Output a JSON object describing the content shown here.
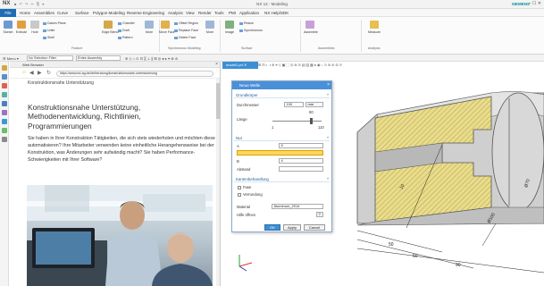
{
  "titlebar": {
    "app_logo": "NX",
    "title": "NX 12 - Modeling",
    "brand": "SIEMENS",
    "window_buttons": "–  ☐  ✕"
  },
  "menu": {
    "file": "File",
    "items": [
      "Home",
      "Assemblies",
      "Curve",
      "Surface",
      "Polygon Modeling",
      "Reverse Engineering",
      "Analysis",
      "View",
      "Render",
      "Tools",
      "PMI",
      "Application",
      "NX Help/SDK"
    ]
  },
  "ribbon": {
    "buttons": [
      "Sketch",
      "Extrude",
      "Hole",
      "Edge Blend",
      "Chamfer",
      "More",
      "Image",
      "Replace Face",
      "More",
      "Assemble",
      "Measure"
    ],
    "small": [
      "Datum Plane",
      "Unite",
      "Shell",
      "Offset Region",
      "Draft",
      "Delete Face",
      "Synchronous",
      "Pattern",
      "Move Face",
      "Resize",
      "Image"
    ],
    "groups": [
      "Feature",
      "Synchronous Modeling",
      "Surface",
      "Assemblies",
      "Analysis"
    ]
  },
  "toolbar2": {
    "menu_label": "Menu",
    "filter_value": "No Selection Filter",
    "scope_value": "Entire Assembly"
  },
  "web": {
    "panel_title": "Web Browser",
    "url": "https://www.ed-ag.de/de/beratung/konstruktionsnahe-unterstuetzung",
    "breadcrumb": "Konstruktionsnahe Unterstützung",
    "heading_line1": "Konstruktionsnahe Unterstützung,",
    "heading_line2": "Methodenentwicklung, Richtlinien,",
    "heading_line3": "Programmierungen",
    "body": "Sie haben in Ihrer Konstruktion Tätigkeiten, die sich stets wiederholen und möchten diese automatisieren? Ihre Mitarbeiter verwenden keine einheitliche Herangehensweise bei der Konstruktion, was Änderungen sehr aufwändig macht? Sie haben Performance-Schwierigkeiten mit Ihrer Software?"
  },
  "viewport": {
    "tab": "model1.prt"
  },
  "dialog": {
    "title": "Neue Welle",
    "sec_grundkoerper": "Grundkörper",
    "durchmesser_label": "Durchmesser",
    "durchmesser_value": "100",
    "durchmesser_unit": "mm",
    "laenge_label": "Länge",
    "laenge_value": "90",
    "slider_min": "1",
    "slider_max": "110",
    "sec_nut": "Nut",
    "a_label": "A",
    "a_value": "5",
    "abstand1_label": "Abstand",
    "abstand1_value": "",
    "b_label": "B",
    "b_value": "4",
    "abstand2_label": "Abstand",
    "abstand2_value": "",
    "sec_kante": "Kantenbehandlung",
    "fase_label": "Fase",
    "verrundung_label": "Verrundung",
    "material_label": "Material",
    "material_value": "Aluminum_2014",
    "hilfe_label": "Hilfe öffnen",
    "ok": "OK",
    "apply": "Apply",
    "cancel": "Cancel"
  },
  "drawing": {
    "dim_10": "10",
    "dim_50": "50",
    "dim_60": "60",
    "dim_90": "90",
    "dim_d70": "Ø70",
    "dim_d100": "Ø100"
  }
}
